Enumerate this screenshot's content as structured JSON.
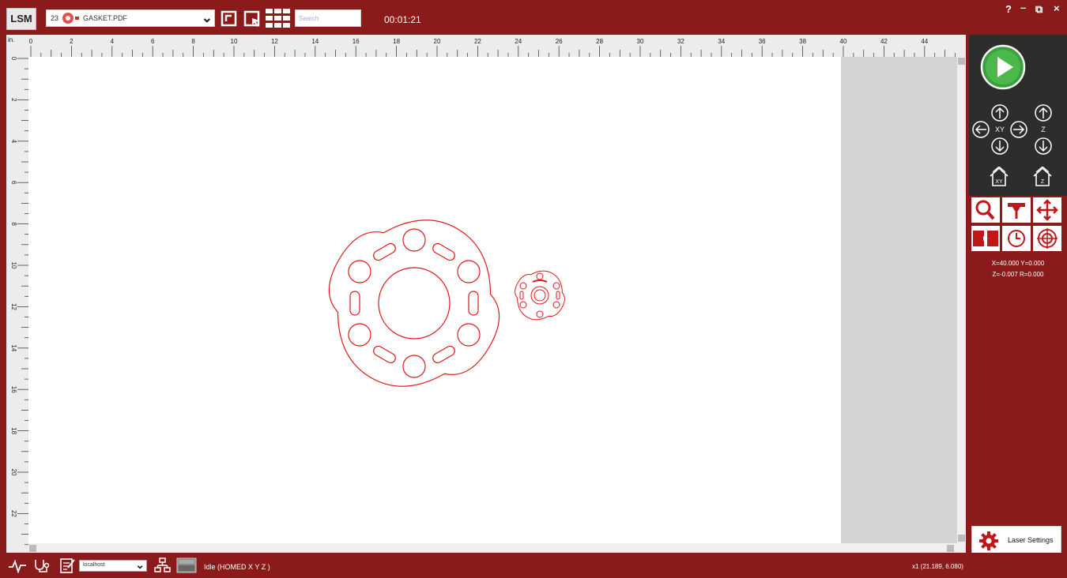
{
  "app": {
    "logo": "LSM"
  },
  "toolbar": {
    "job_count": "23",
    "job_name": "GASKET.PDF",
    "search_placeholder": "Search",
    "timer": "00:01:21"
  },
  "window_controls": {
    "help": "?",
    "minimize": "–",
    "restore": "⧉",
    "close": "×"
  },
  "ruler": {
    "unit": "in.",
    "top_ticks": [
      "0",
      "2",
      "4",
      "6",
      "8",
      "10",
      "12",
      "14",
      "16",
      "18",
      "20",
      "22",
      "24",
      "26",
      "28",
      "30",
      "32",
      "34",
      "36",
      "38",
      "40",
      "42",
      "44"
    ],
    "left_ticks": [
      "0",
      "2",
      "4",
      "6",
      "8",
      "10",
      "12",
      "14",
      "16",
      "18",
      "20",
      "22"
    ]
  },
  "machine": {
    "axis_xy_label": "XY",
    "axis_z_label": "Z",
    "home_xy_label": "XY",
    "home_z_label": "Z",
    "position_line1": "X=40.000  Y=0.000",
    "position_line2": "Z=-0.007  R=0.000"
  },
  "laser_settings_label": "Laser Settings",
  "statusbar": {
    "host": "localhost",
    "status": "Idle (HOMED X Y Z )",
    "cursor": "x1  (21.189, 6.080)"
  },
  "colors": {
    "brand": "#8b1a1a",
    "panel_dark": "#2d2d2d",
    "drawing": "#e01818",
    "go_button": "#3aa03a"
  }
}
